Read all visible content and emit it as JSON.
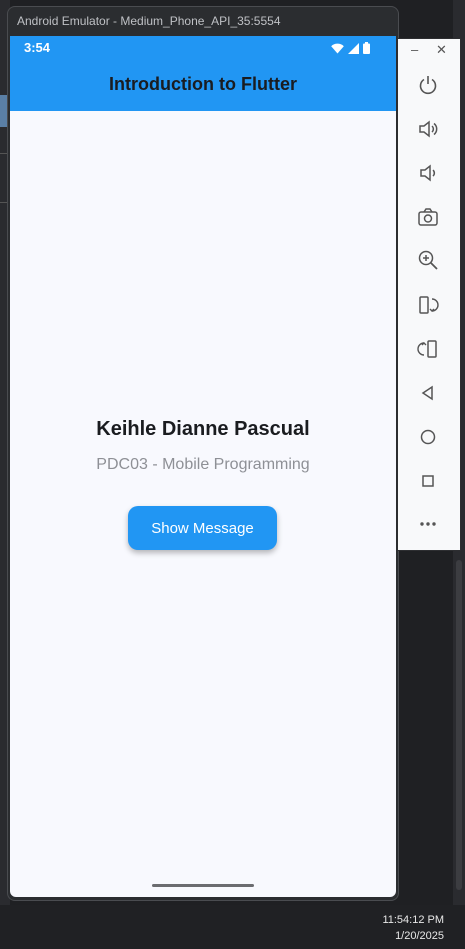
{
  "emulator": {
    "window_title": "Android Emulator - Medium_Phone_API_35:5554"
  },
  "status_bar": {
    "time": "3:54",
    "icons": [
      "wifi-icon",
      "cellular-icon",
      "battery-icon"
    ]
  },
  "app_bar": {
    "title": "Introduction to Flutter"
  },
  "main": {
    "name": "Keihle Dianne Pascual",
    "subtitle": "PDC03 - Mobile Programming",
    "button_label": "Show Message"
  },
  "toolbar": {
    "minimize_label": "–",
    "close_label": "✕",
    "buttons": [
      "power-icon",
      "volume-up-icon",
      "volume-down-icon",
      "camera-icon",
      "zoom-in-icon",
      "rotate-left-icon",
      "rotate-right-icon",
      "back-icon",
      "home-icon",
      "overview-icon",
      "more-icon"
    ]
  },
  "taskbar": {
    "time": "11:54:12 PM",
    "date": "1/20/2025"
  },
  "colors": {
    "primary": "#2196f3",
    "background": "#f8f9fe",
    "title_text": "#1a1c20",
    "subtitle_text": "#8e9096"
  }
}
